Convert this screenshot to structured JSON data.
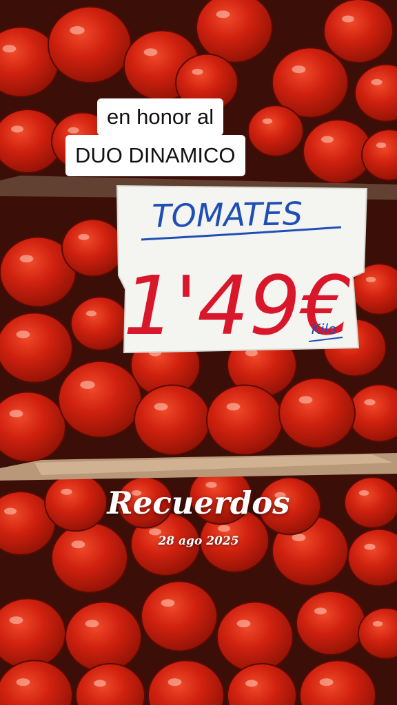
{
  "caption": {
    "line1": "en honor al",
    "line2": "DUO DINAMICO"
  },
  "sign": {
    "product": "TOMATES",
    "price": "1'49€",
    "unit": "Kilo"
  },
  "overlay": {
    "title": "Recuerdos",
    "date": "28 ago 2025"
  },
  "colors": {
    "tomato": "#d0210f",
    "tomato_dark": "#8e1205",
    "sign_paper": "#f4f4f1",
    "sign_blue": "#1f4fb5",
    "sign_red": "#d8182a"
  }
}
